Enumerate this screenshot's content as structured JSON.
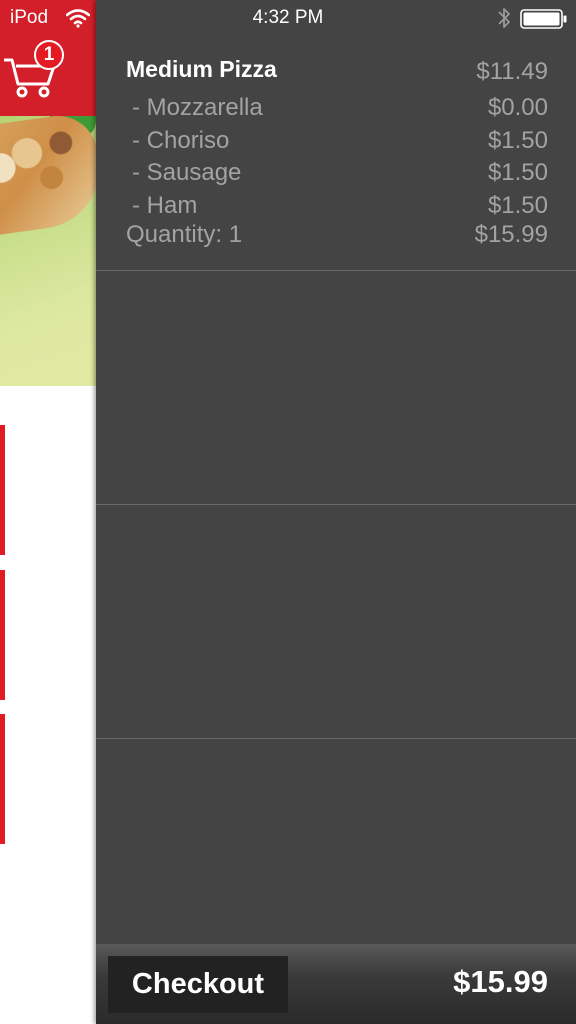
{
  "status_bar": {
    "carrier": "iPod",
    "time": "4:32 PM"
  },
  "cart_badge": {
    "count": "1"
  },
  "colors": {
    "brand_red": "#d21f2a",
    "drawer_bg": "#444444",
    "muted_text": "#a3a3a3"
  },
  "icons": [
    "wifi-icon",
    "bluetooth-icon",
    "battery-icon",
    "cart-icon"
  ],
  "cart": {
    "items": [
      {
        "name": "Medium Pizza",
        "base_price": "$11.49",
        "options": [
          {
            "label": "- Mozzarella",
            "price": "$0.00"
          },
          {
            "label": "- Choriso",
            "price": "$1.50"
          },
          {
            "label": "- Sausage",
            "price": "$1.50"
          },
          {
            "label": "- Ham",
            "price": "$1.50"
          }
        ],
        "quantity_label": "Quantity: 1",
        "line_total": "$15.99"
      }
    ]
  },
  "footer": {
    "checkout_label": "Checkout",
    "total": "$15.99"
  }
}
